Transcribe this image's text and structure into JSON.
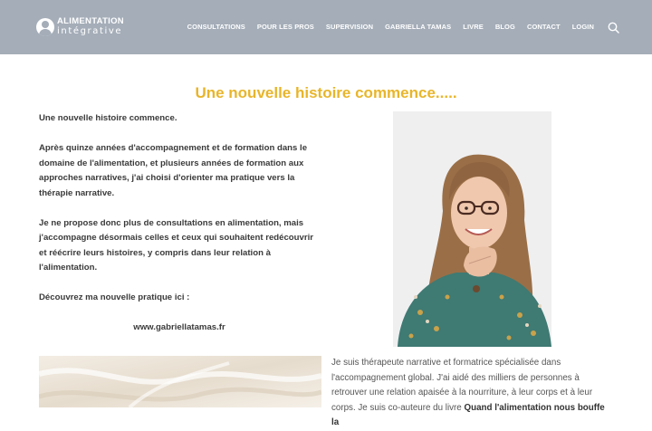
{
  "brand": {
    "line1": "ALIMENTATION",
    "line2": "intégrative"
  },
  "nav": [
    "CONSULTATIONS",
    "POUR LES PROS",
    "SUPERVISION",
    "GABRIELLA TAMAS",
    "LIVRE",
    "BLOG",
    "CONTACT",
    "LOGIN"
  ],
  "icons": {
    "logo": "person-silhouette-icon",
    "search": "search-icon"
  },
  "colors": {
    "header": "#a4adb8",
    "title": "#e8b52a",
    "text": "#3a3a3a"
  },
  "main": {
    "title": "Une nouvelle histoire commence.....",
    "p1": "Une nouvelle histoire commence.",
    "p2": "Après quinze années d'accompagnement et de formation dans le domaine de l'alimentation, et plusieurs années de formation aux approches narratives, j'ai choisi d'orienter ma pratique vers la thérapie narrative.",
    "p3": "Je ne propose donc plus de consultations en alimentation, mais j'accompagne désormais celles et ceux qui souhaitent redécouvrir et réécrire leurs histoires, y compris dans leur relation à l'alimentation.",
    "p4": "Découvrez ma nouvelle pratique ici :",
    "link": "www.gabriellatamas.fr"
  },
  "bio": {
    "text": "Je suis thérapeute narrative et formatrice spécialisée dans l'accompagnement global. J'ai aidé des milliers de personnes à retrouver une relation apaisée à la nourriture, à leur corps et à leur ",
    "text2": "corps. Je suis co-auteure du livre ",
    "book": "Quand l'alimentation nous bouffe la"
  }
}
